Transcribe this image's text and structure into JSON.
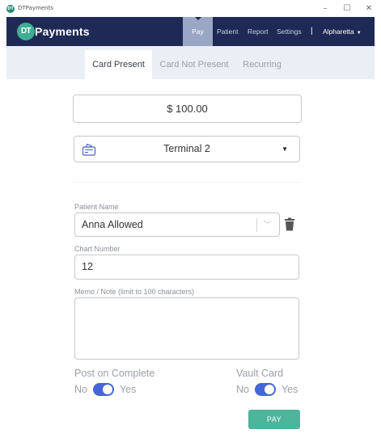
{
  "window": {
    "logo_text": "DT",
    "title": "DTPayments",
    "minimize_glyph": "–",
    "maximize_glyph": "☐",
    "close_glyph": "✕"
  },
  "navbar": {
    "brand_badge": "DT",
    "brand_text": "Payments",
    "items": [
      {
        "label": "Pay",
        "active": true
      },
      {
        "label": "Patient",
        "active": false
      },
      {
        "label": "Report",
        "active": false
      },
      {
        "label": "Settings",
        "active": false
      }
    ],
    "separator": "|",
    "location": "Alpharetta",
    "location_caret": "▼"
  },
  "tabs": [
    {
      "label": "Card Present",
      "active": true
    },
    {
      "label": "Card Not Present",
      "active": false
    },
    {
      "label": "Recurring",
      "active": false
    }
  ],
  "form": {
    "amount": "$ 100.00",
    "terminal": {
      "value": "Terminal 2",
      "icon": "card-terminal-icon",
      "caret": "▼"
    },
    "patient": {
      "label": "Patient Name",
      "value": "Anna Allowed",
      "chevron": "﹀"
    },
    "chart": {
      "label": "Chart Number",
      "value": "12"
    },
    "memo": {
      "label": "Memo / Note (limit to 100 characters)",
      "value": ""
    },
    "post_on_complete": {
      "title": "Post on Complete",
      "off_label": "No",
      "on_label": "Yes",
      "state": true
    },
    "vault_card": {
      "title": "Vault Card",
      "off_label": "No",
      "on_label": "Yes",
      "state": true
    },
    "pay_button": "PAY"
  },
  "colors": {
    "navbar": "#1e2a55",
    "brand_accent": "#3fae93",
    "active_nav": "#9aa7c4",
    "tabstrip": "#eaeef5",
    "toggle_on": "#4466d8",
    "pay_button": "#4cb59b"
  }
}
